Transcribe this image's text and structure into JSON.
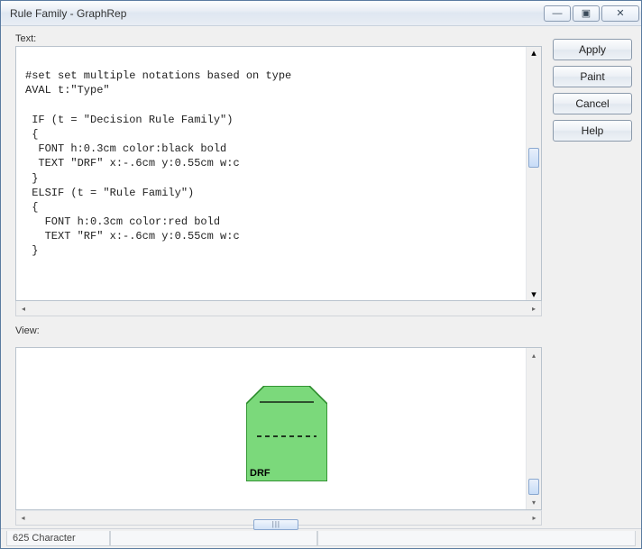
{
  "window": {
    "title": "Rule Family - GraphRep",
    "controls": {
      "minimize": "—",
      "maximize": "▣",
      "close": "✕"
    }
  },
  "labels": {
    "text_section": "Text:",
    "view_section": "View:"
  },
  "code": "\n#set set multiple notations based on type\nAVAL t:\"Type\"\n\n IF (t = \"Decision Rule Family\")\n {\n  FONT h:0.3cm color:black bold\n  TEXT \"DRF\" x:-.6cm y:0.55cm w:c\n }\n ELSIF (t = \"Rule Family\")\n {\n   FONT h:0.3cm color:red bold\n   TEXT \"RF\" x:-.6cm y:0.55cm w:c\n }",
  "buttons": {
    "apply": "Apply",
    "paint": "Paint",
    "cancel": "Cancel",
    "help": "Help"
  },
  "view": {
    "shape_label": "DRF",
    "shape_fill": "#7bd97b",
    "shape_stroke": "#2a8a2a",
    "scroll_grip": "|||"
  },
  "statusbar": {
    "cell1": "625 Character",
    "cell2": "",
    "cell3": ""
  }
}
